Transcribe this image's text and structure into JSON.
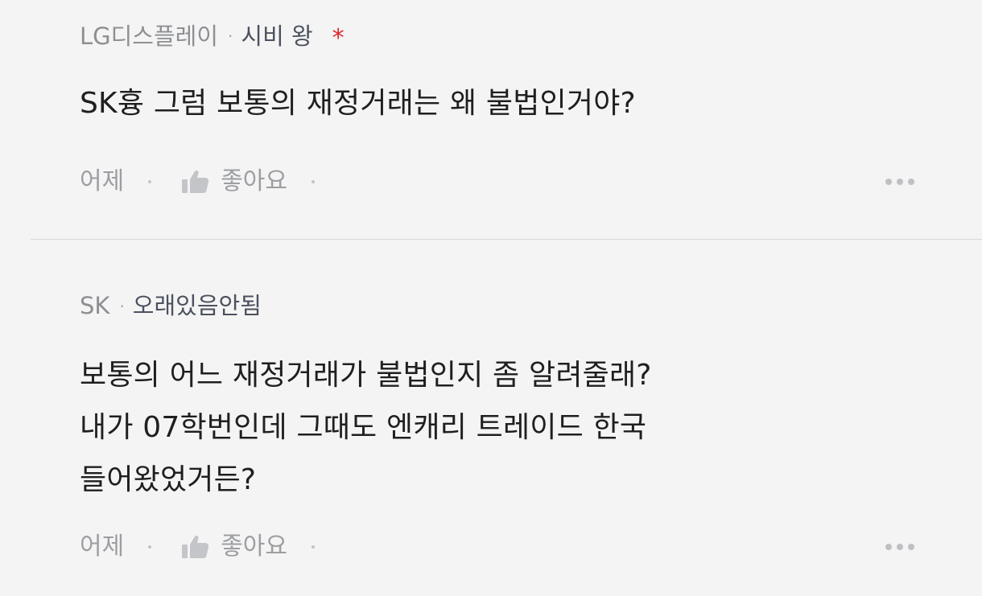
{
  "comments": [
    {
      "company": "LG디스플레이",
      "nickname": "시비 왕",
      "badge_symbol": "*",
      "body_lines": [
        "SK흉 그럼 보통의 재정거래는 왜 불법인거야?"
      ],
      "time": "어제",
      "like_label": "좋아요",
      "more_icon": "more-horizontal-icon",
      "like_icon": "thumbs-up-icon"
    },
    {
      "company": "SK",
      "nickname": "오래있음안됨",
      "body_lines": [
        "보통의 어느 재정거래가 불법인지 좀 알려줄래?",
        "내가 07학번인데 그때도 엔캐리 트레이드 한국",
        "들어왔었거든?"
      ],
      "time": "어제",
      "like_label": "좋아요",
      "more_icon": "more-horizontal-icon",
      "like_icon": "thumbs-up-icon"
    }
  ],
  "colors": {
    "background": "#f4f4f4",
    "badge": "#e0262a",
    "meta_text": "#8d8f93",
    "nickname": "#4c5160",
    "body_text": "#1f1f1f"
  }
}
